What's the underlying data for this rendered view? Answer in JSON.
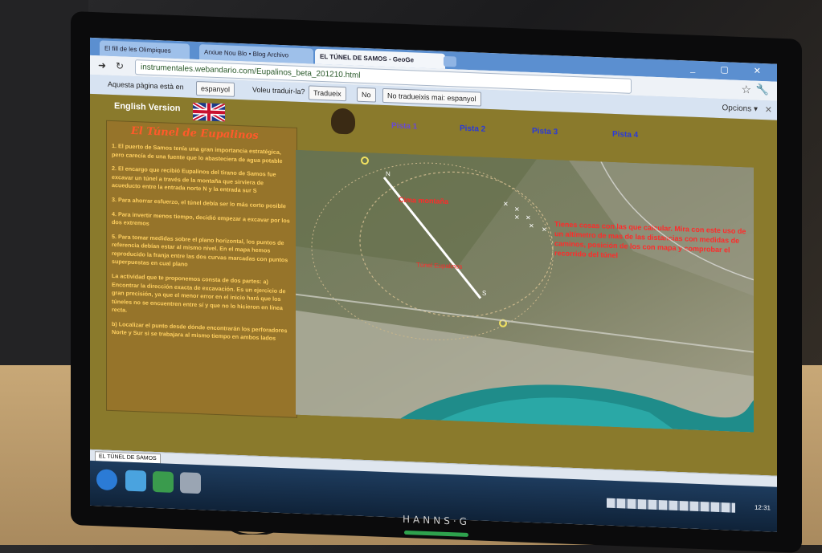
{
  "browser": {
    "tabs": [
      "El fill de les Olimpiques",
      "Arxiue Nou Blo • Blog Archivo",
      "EL TÚNEL DE SAMOS - GeoGe"
    ],
    "url": "instrumentales.webandario.com/Eupalinos_beta_201210.html",
    "translate_bar": {
      "prompt": "Aquesta pàgina està en",
      "language": "espanyol",
      "question": "Voleu traduir-la?",
      "translate_btn": "Tradueix",
      "no_btn": "No",
      "never_btn": "No tradueixis mai: espanyol",
      "options": "Opcions ▾"
    }
  },
  "page": {
    "english_link": "English Version",
    "nav": [
      "Pista 1",
      "Pista 2",
      "Pista 3",
      "Pista 4"
    ],
    "title": "El Túnel de Eupalinos",
    "paragraphs": [
      "1. El puerto de Samos tenía una gran importancia estratégica, pero carecía de una fuente que lo abasteciera de agua potable",
      "2. El encargo que recibió Eupalinos del tirano de Samos fue excavar un túnel a través de la montaña que sirviera de acueducto entre la entrada norte N y la entrada sur S",
      "3. Para ahorrar esfuerzo, el túnel debía ser lo más corto posible",
      "4. Para invertir menos tiempo, decidió empezar a excavar por los dos extremos",
      "5. Para tomar medidas sobre el plano horizontal, los puntos de referencia debían estar al mismo nivel. En el mapa hemos reproducido la franja entre las dos curvas marcadas con puntos superpuestas en cual plano",
      "La actividad que te proponemos consta de dos partes: a) Encontrar la dirección exacta de excavación. Es un ejercicio de gran precisión, ya que el menor error en el inicio hará que los túneles no se encuentren entre sí y que no lo hicieron en línea recta.",
      "b) Localizar el punto desde dónde encontrarán los perforadores Norte y Sur si se trabajara al mismo tiempo en ambos lados"
    ],
    "map_labels": {
      "north": "N",
      "south": "S",
      "hill_label": "Cima montaña",
      "tunnel_label": "Túnel Eupalinos",
      "red_note": "Tienes cosas con las que calcular. Mira con este uso de un altímetro de mas de las distancias con medidas de caminos, posición de los con mapa y comprobar el recorrido del túnel"
    }
  },
  "statusbar": {
    "download": "EL TÚNEL DE SAMOS"
  },
  "taskbar": {
    "clock": "12:31"
  },
  "monitor": {
    "brand": "HANNS·G"
  },
  "colors": {
    "page_bg": "#8a7a2c",
    "title": "#ff5a2a",
    "text": "#ffd060",
    "nav": "#2a3ad8"
  }
}
